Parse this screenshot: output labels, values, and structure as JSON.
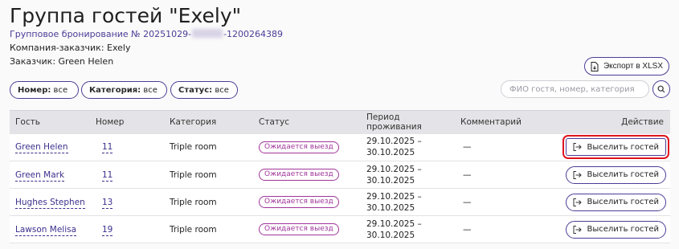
{
  "page": {
    "title": "Группа гостей \"Exely\"",
    "booking_prefix": "Групповое бронирование № 20251029-",
    "booking_suffix": "-1200264389",
    "company": "Компания-заказчик: Exely",
    "customer": "Заказчик: Green Helen"
  },
  "toolbar": {
    "export_label": "Экспорт в XLSX",
    "search_placeholder": "ФИО гостя, номер, категория"
  },
  "filters": [
    {
      "name": "Номер:",
      "value": "все"
    },
    {
      "name": "Категория:",
      "value": "все"
    },
    {
      "name": "Статус:",
      "value": "все"
    }
  ],
  "table": {
    "headers": [
      "Гость",
      "Номер",
      "Категория",
      "Статус",
      "Период проживания",
      "Комментарий",
      "Действие"
    ],
    "rows": [
      {
        "guest": "Green Helen",
        "room": "11",
        "category": "Triple room",
        "status": "Ожидается выезд",
        "period_start": "29.10.2025 –",
        "period_end": "30.10.2025",
        "comment": "—",
        "action": "Выселить гостей"
      },
      {
        "guest": "Green Mark",
        "room": "11",
        "category": "Triple room",
        "status": "Ожидается выезд",
        "period_start": "29.10.2025 –",
        "period_end": "30.10.2025",
        "comment": "—",
        "action": "Выселить гостей"
      },
      {
        "guest": "Hughes Stephen",
        "room": "13",
        "category": "Triple room",
        "status": "Ожидается выезд",
        "period_start": "29.10.2025 –",
        "period_end": "30.10.2025",
        "comment": "—",
        "action": "Выселить гостей"
      },
      {
        "guest": "Lawson Melisa",
        "room": "19",
        "category": "Triple room",
        "status": "Ожидается выезд",
        "period_start": "29.10.2025 –",
        "period_end": "30.10.2025",
        "comment": "—",
        "action": "Выселить гостей"
      }
    ]
  },
  "colors": {
    "accent": "#4b3d96",
    "status_badge": "#a0359a",
    "highlight": "#e0131d"
  }
}
